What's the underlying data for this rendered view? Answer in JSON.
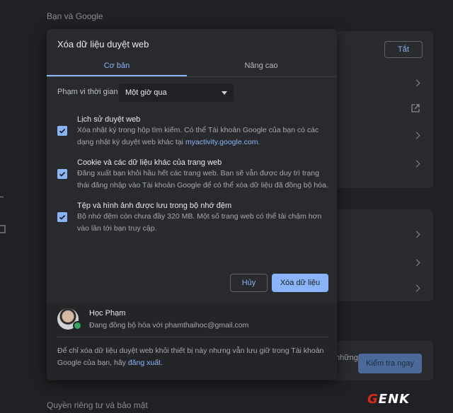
{
  "background": {
    "section_you_google": "Bạn và Google",
    "turn_on_button": "Tắt",
    "partial_text": "những",
    "check_now_button": "Kiểm tra ngay",
    "section_privacy": "Quyền riêng tư và bảo mật"
  },
  "dialog": {
    "title": "Xóa dữ liệu duyệt web",
    "tabs": [
      {
        "label": "Cơ bản",
        "active": true
      },
      {
        "label": "Nâng cao",
        "active": false
      }
    ],
    "time_range": {
      "label": "Phạm vi thời gian",
      "selected": "Một giờ qua"
    },
    "options": [
      {
        "title": "Lịch sử duyệt web",
        "desc": "Xóa nhật ký trong hộp tìm kiếm. Có thể Tài khoản Google của bạn có các dạng nhật ký duyệt web khác tại",
        "link": "myactivity.google.com",
        "suffix": ".",
        "checked": true
      },
      {
        "title": "Cookie và các dữ liệu khác của trang web",
        "desc": "Đăng xuất bạn khỏi hầu hết các trang web. Bạn sẽ vẫn được duy trì trạng thái đăng nhập vào Tài khoản Google để có thể xóa dữ liệu đã đồng bộ hóa.",
        "checked": true
      },
      {
        "title": "Tệp và hình ảnh được lưu trong bộ nhớ đệm",
        "desc": "Bộ nhớ đệm còn chưa đầy 320 MB. Một số trang web có thể tải chậm hơn vào lần tới bạn truy cập.",
        "checked": true
      }
    ],
    "cancel_label": "Hủy",
    "clear_label": "Xóa dữ liệu",
    "account": {
      "name": "Học Phạm",
      "status": "Đang đồng bộ hóa với phamthaihoc@gmail.com"
    },
    "footer": {
      "text": "Để chỉ xóa dữ liệu duyệt web khỏi thiết bị này nhưng vẫn lưu giữ trong Tài khoản Google của bạn, hãy",
      "link": "đăng xuất",
      "suffix": "."
    }
  },
  "watermark": {
    "g": "G",
    "rest": "ENK"
  },
  "colors": {
    "accent": "#8ab4f8",
    "dialog_bg": "#292a2d",
    "page_bg": "#202124"
  }
}
